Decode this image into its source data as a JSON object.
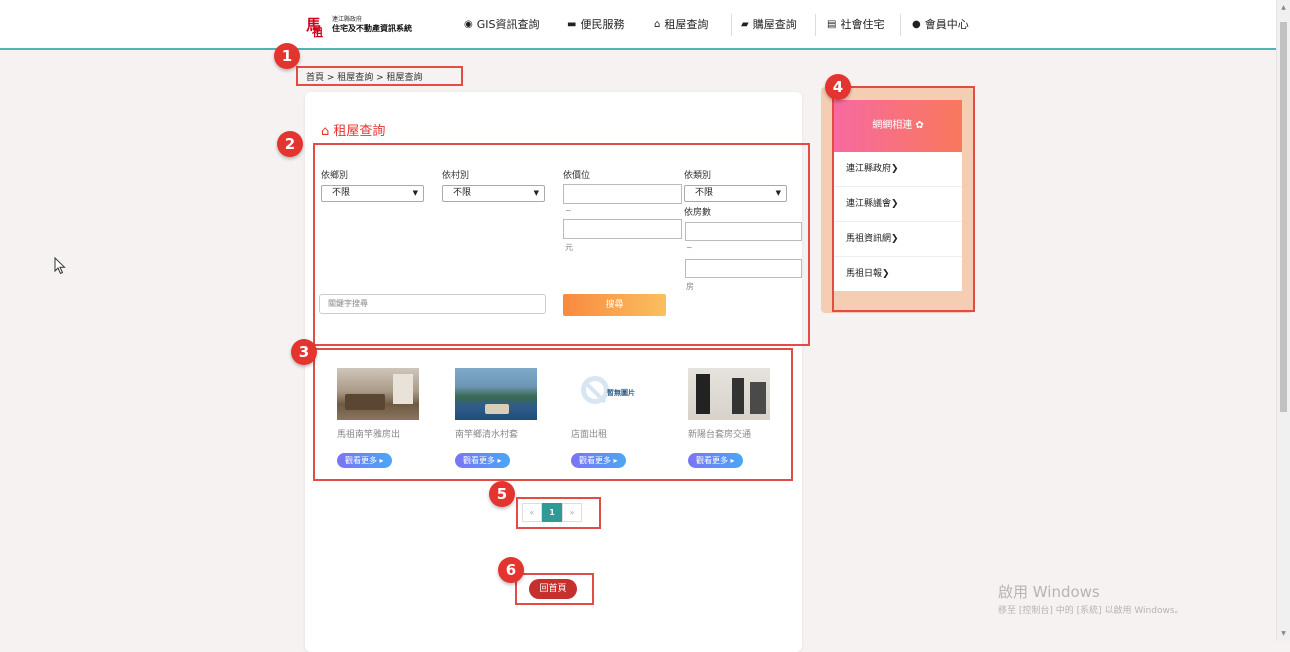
{
  "header": {
    "logo_small": "連江縣政府",
    "logo_main": "住宅及不動產資訊系統",
    "nav": [
      {
        "label": "GIS資訊查詢",
        "icon": "globe-icon"
      },
      {
        "label": "便民服務",
        "icon": "briefcase-icon"
      },
      {
        "label": "租屋查詢",
        "icon": "home-icon"
      },
      {
        "label": "購屋查詢",
        "icon": "book-icon"
      },
      {
        "label": "社會住宅",
        "icon": "building-icon"
      },
      {
        "label": "會員中心",
        "icon": "user-icon"
      }
    ]
  },
  "breadcrumb": "首頁 > 租屋查詢 > 租屋查詢",
  "main": {
    "title": "租屋查詢",
    "filters": {
      "township_label": "依鄉別",
      "township_value": "不限",
      "village_label": "依村別",
      "village_value": "不限",
      "price_label": "依價位",
      "price_sep": "~",
      "price_unit": "元",
      "type_label": "依類別",
      "type_value": "不限",
      "rooms_label": "依房數",
      "rooms_sep": "~",
      "rooms_unit": "房",
      "keyword_placeholder": "關鍵字搜尋",
      "search_button": "搜尋"
    },
    "listings": [
      {
        "name": "馬祖南竿雅房出",
        "more": "觀看更多"
      },
      {
        "name": "南竿鄉清水村套",
        "more": "觀看更多"
      },
      {
        "name": "店面出租",
        "more": "觀看更多",
        "no_image_text": "暫無圖片"
      },
      {
        "name": "新陽台套房交通",
        "more": "觀看更多"
      }
    ],
    "pagination": {
      "prev": "«",
      "current": "1",
      "next": "»"
    },
    "home_button": "回首頁"
  },
  "sidebar": {
    "title": "網網相連",
    "links": [
      "連江縣政府",
      "連江縣議會",
      "馬祖資訊網",
      "馬祖日報"
    ]
  },
  "annotations": [
    "1",
    "2",
    "3",
    "4",
    "5",
    "6"
  ],
  "watermark": {
    "line1": "啟用 Windows",
    "line2": "移至 [控制台] 中的 [系統] 以啟用 Windows。"
  },
  "colors": {
    "accent_red": "#e3342f",
    "teal": "#4bb6b3",
    "orange": "#f88a3f"
  }
}
